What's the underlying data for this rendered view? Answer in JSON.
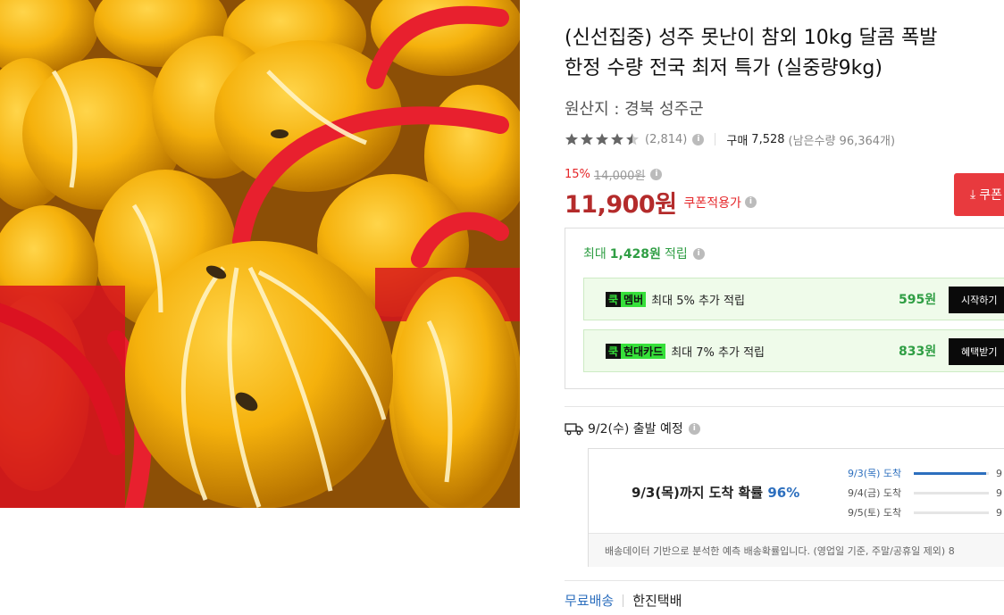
{
  "product": {
    "title_line1": "(신선집중) 성주 못난이 참외 10kg 달콤 폭발",
    "title_line2": "한정 수량 전국 최저 특가 (실중량9kg)",
    "origin": "원산지 : 경북 성주군",
    "image_icon": "korean-melon-photo"
  },
  "rating": {
    "stars": 4.5,
    "review_count": "(2,814)",
    "purchase_label": "구매",
    "purchase_count": "7,528",
    "remaining": "(남은수량 96,364개)"
  },
  "price": {
    "discount_rate": "15%",
    "original_price": "14,000원",
    "sale_price": "11,900원",
    "coupon_applied": "쿠폰적용가",
    "coupon_button": "쿠폰"
  },
  "points": {
    "max_label": "최대",
    "max_amount": "1,428원",
    "earn_label": "적립",
    "benefits": [
      {
        "badge_a": "쿡",
        "badge_b": "멤버",
        "text": "최대 5% 추가 적립",
        "amount": "595원",
        "button": "시작하기"
      },
      {
        "badge_a": "쿡",
        "badge_b": "현대카드",
        "text": "최대 7% 추가 적립",
        "amount": "833원",
        "button": "혜택받기"
      }
    ]
  },
  "shipping": {
    "departure": "9/2(수) 출발 예정",
    "prob_prefix": "9/3(목)까지 도착 확률",
    "prob_value": "96%",
    "dates": [
      {
        "label": "9/3(목) 도착",
        "fill": 0.96,
        "pct": "9"
      },
      {
        "label": "9/4(금) 도착",
        "fill": 0.0,
        "pct": "9"
      },
      {
        "label": "9/5(토) 도착",
        "fill": 0.0,
        "pct": "9"
      }
    ],
    "note": "배송데이터 기반으로 분석한 예측 배송확률입니다. (영업일 기준, 주말/공휴일 제외) 8",
    "free_shipping": "무료배송",
    "carrier": "한진택배"
  },
  "colors": {
    "price_red": "#b42b2b",
    "accent_red": "#e83a3e",
    "point_green": "#2f9e44",
    "badge_green": "#36e03a",
    "link_blue": "#2d6fbe"
  }
}
